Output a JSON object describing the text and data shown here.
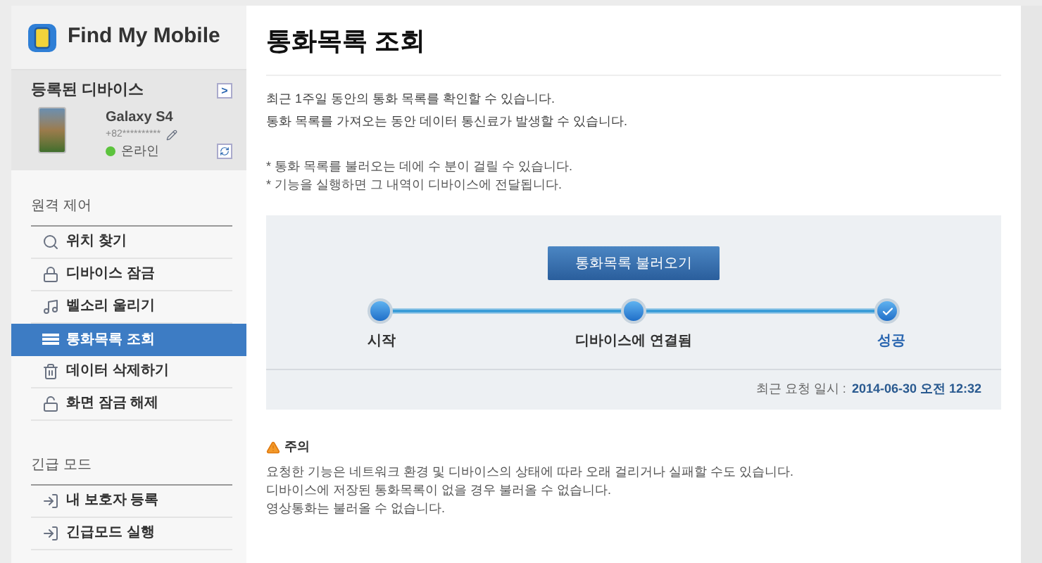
{
  "app": {
    "name": "Find My Mobile"
  },
  "devices": {
    "title": "등록된 디바이스",
    "arrow": ">",
    "device": {
      "name": "Galaxy S4",
      "number": "+82**********",
      "status": "온라인",
      "online": true
    }
  },
  "sidebar": [
    {
      "title": "원격 제어",
      "items": [
        {
          "label": "위치 찾기",
          "kind": "search",
          "selected": false
        },
        {
          "label": "디바이스 잠금",
          "kind": "lock",
          "selected": false
        },
        {
          "label": "벨소리 울리기",
          "kind": "music",
          "selected": false
        },
        {
          "label": "통화목록 조회",
          "kind": "list",
          "selected": true
        },
        {
          "label": "데이터 삭제하기",
          "kind": "trash",
          "selected": false
        },
        {
          "label": "화면 잠금 해제",
          "kind": "unlock",
          "selected": false
        }
      ]
    },
    {
      "title": "긴급 모드",
      "items": [
        {
          "label": "내 보호자 등록",
          "kind": "exit",
          "selected": false
        },
        {
          "label": "긴급모드 실행",
          "kind": "exit",
          "selected": false
        }
      ]
    }
  ],
  "page": {
    "title": "통화목록 조회",
    "intro": [
      "최근 1주일 동안의 통화 목록를 확인할 수 있습니다.",
      "통화 목록를 가져오는 동안 데이터 통신료가 발생할 수 있습니다."
    ],
    "notes": [
      "* 통화 목록를 불러오는 데에 수 분이 걸릴 수 있습니다.",
      "* 기능을 실행하면 그 내역이 디바이스에 전달됩니다."
    ],
    "button": "통화목록 불러오기",
    "steps": [
      {
        "label": "시작",
        "kind": "dot"
      },
      {
        "label": "디바이스에 연결됨",
        "kind": "dot"
      },
      {
        "label": "성공",
        "kind": "check"
      }
    ],
    "last_request_label": "최근 요청 일시 :",
    "last_request_value": "2014-06-30 오전 12:32",
    "caution": {
      "title": "주의",
      "lines": [
        "요청한 기능은 네트워크 환경 및 디바이스의 상태에 따라 오래 걸리거나 실패할 수도 있습니다.",
        "디바이스에 저장된 통화목록이 없을 경우 불러올 수 없습니다.",
        "영상통화는 불러올 수 없습니다."
      ]
    }
  }
}
